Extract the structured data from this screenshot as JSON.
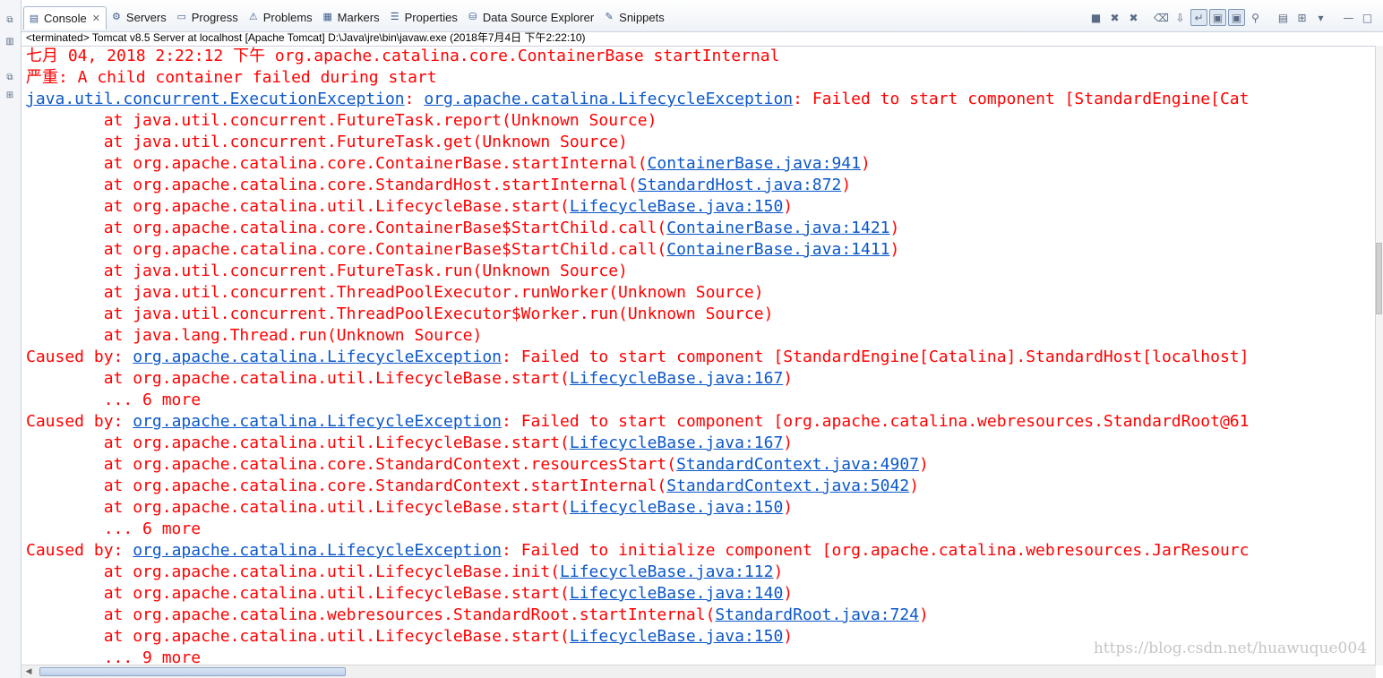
{
  "sidebar": {
    "icons": [
      "restore-icon",
      "panel-icon",
      "restore-icon",
      "hierarchy-icon"
    ]
  },
  "tabs": [
    {
      "label": "Console",
      "active": true,
      "icon": "console-icon"
    },
    {
      "label": "Servers",
      "icon": "servers-icon"
    },
    {
      "label": "Progress",
      "icon": "progress-icon"
    },
    {
      "label": "Problems",
      "icon": "problems-icon"
    },
    {
      "label": "Markers",
      "icon": "markers-icon"
    },
    {
      "label": "Properties",
      "icon": "properties-icon"
    },
    {
      "label": "Data Source Explorer",
      "icon": "data-source-explorer-icon"
    },
    {
      "label": "Snippets",
      "icon": "snippets-icon"
    }
  ],
  "toolbar": {
    "buttons": [
      "terminate-icon",
      "remove-launch-icon",
      "remove-all-terminated-icon",
      "clear-console-icon",
      "scroll-lock-icon",
      "word-wrap-icon",
      "show-on-stdout-icon",
      "show-on-stderr-icon",
      "pin-console-icon",
      "display-console-icon",
      "open-console-icon",
      "view-menu-icon",
      "minimize-icon",
      "maximize-icon"
    ]
  },
  "status": "<terminated> Tomcat v8.5 Server at localhost [Apache Tomcat] D:\\Java\\jre\\bin\\javaw.exe (2018年7月4日 下午2:22:10)",
  "console": {
    "lines": [
      [
        {
          "t": "七月 04, 2018 2:22:12 下午 org.apache.catalina.core.ContainerBase startInternal"
        }
      ],
      [
        {
          "t": "严重: A child container failed during start"
        }
      ],
      [
        {
          "t": "java.util.concurrent.ExecutionException",
          "link": true
        },
        {
          "t": ": "
        },
        {
          "t": "org.apache.catalina.LifecycleException",
          "link": true
        },
        {
          "t": ": Failed to start component [StandardEngine[Cat"
        }
      ],
      [
        {
          "t": "\tat java.util.concurrent.FutureTask.report(Unknown Source)"
        }
      ],
      [
        {
          "t": "\tat java.util.concurrent.FutureTask.get(Unknown Source)"
        }
      ],
      [
        {
          "t": "\tat org.apache.catalina.core.ContainerBase.startInternal("
        },
        {
          "t": "ContainerBase.java:941",
          "link": true
        },
        {
          "t": ")"
        }
      ],
      [
        {
          "t": "\tat org.apache.catalina.core.StandardHost.startInternal("
        },
        {
          "t": "StandardHost.java:872",
          "link": true
        },
        {
          "t": ")"
        }
      ],
      [
        {
          "t": "\tat org.apache.catalina.util.LifecycleBase.start("
        },
        {
          "t": "LifecycleBase.java:150",
          "link": true
        },
        {
          "t": ")"
        }
      ],
      [
        {
          "t": "\tat org.apache.catalina.core.ContainerBase$StartChild.call("
        },
        {
          "t": "ContainerBase.java:1421",
          "link": true
        },
        {
          "t": ")"
        }
      ],
      [
        {
          "t": "\tat org.apache.catalina.core.ContainerBase$StartChild.call("
        },
        {
          "t": "ContainerBase.java:1411",
          "link": true
        },
        {
          "t": ")"
        }
      ],
      [
        {
          "t": "\tat java.util.concurrent.FutureTask.run(Unknown Source)"
        }
      ],
      [
        {
          "t": "\tat java.util.concurrent.ThreadPoolExecutor.runWorker(Unknown Source)"
        }
      ],
      [
        {
          "t": "\tat java.util.concurrent.ThreadPoolExecutor$Worker.run(Unknown Source)"
        }
      ],
      [
        {
          "t": "\tat java.lang.Thread.run(Unknown Source)"
        }
      ],
      [
        {
          "t": "Caused by: "
        },
        {
          "t": "org.apache.catalina.LifecycleException",
          "link": true
        },
        {
          "t": ": Failed to start component [StandardEngine[Catalina].StandardHost[localhost]"
        }
      ],
      [
        {
          "t": "\tat org.apache.catalina.util.LifecycleBase.start("
        },
        {
          "t": "LifecycleBase.java:167",
          "link": true
        },
        {
          "t": ")"
        }
      ],
      [
        {
          "t": "\t... 6 more"
        }
      ],
      [
        {
          "t": "Caused by: "
        },
        {
          "t": "org.apache.catalina.LifecycleException",
          "link": true
        },
        {
          "t": ": Failed to start component [org.apache.catalina.webresources.StandardRoot@61"
        }
      ],
      [
        {
          "t": "\tat org.apache.catalina.util.LifecycleBase.start("
        },
        {
          "t": "LifecycleBase.java:167",
          "link": true
        },
        {
          "t": ")"
        }
      ],
      [
        {
          "t": "\tat org.apache.catalina.core.StandardContext.resourcesStart("
        },
        {
          "t": "StandardContext.java:4907",
          "link": true
        },
        {
          "t": ")"
        }
      ],
      [
        {
          "t": "\tat org.apache.catalina.core.StandardContext.startInternal("
        },
        {
          "t": "StandardContext.java:5042",
          "link": true
        },
        {
          "t": ")"
        }
      ],
      [
        {
          "t": "\tat org.apache.catalina.util.LifecycleBase.start("
        },
        {
          "t": "LifecycleBase.java:150",
          "link": true
        },
        {
          "t": ")"
        }
      ],
      [
        {
          "t": "\t... 6 more"
        }
      ],
      [
        {
          "t": "Caused by: "
        },
        {
          "t": "org.apache.catalina.LifecycleException",
          "link": true
        },
        {
          "t": ": Failed to initialize component [org.apache.catalina.webresources.JarResourc"
        }
      ],
      [
        {
          "t": "\tat org.apache.catalina.util.LifecycleBase.init("
        },
        {
          "t": "LifecycleBase.java:112",
          "link": true
        },
        {
          "t": ")"
        }
      ],
      [
        {
          "t": "\tat org.apache.catalina.util.LifecycleBase.start("
        },
        {
          "t": "LifecycleBase.java:140",
          "link": true
        },
        {
          "t": ")"
        }
      ],
      [
        {
          "t": "\tat org.apache.catalina.webresources.StandardRoot.startInternal("
        },
        {
          "t": "StandardRoot.java:724",
          "link": true
        },
        {
          "t": ")"
        }
      ],
      [
        {
          "t": "\tat org.apache.catalina.util.LifecycleBase.start("
        },
        {
          "t": "LifecycleBase.java:150",
          "link": true
        },
        {
          "t": ")"
        }
      ],
      [
        {
          "t": "\t... 9 more"
        }
      ]
    ],
    "text_color": "#ff0000",
    "link_color": "#0b57c9"
  },
  "scroll": {
    "horizontal_fraction": 0.23
  },
  "watermark": "https://blog.csdn.net/huawuque004"
}
